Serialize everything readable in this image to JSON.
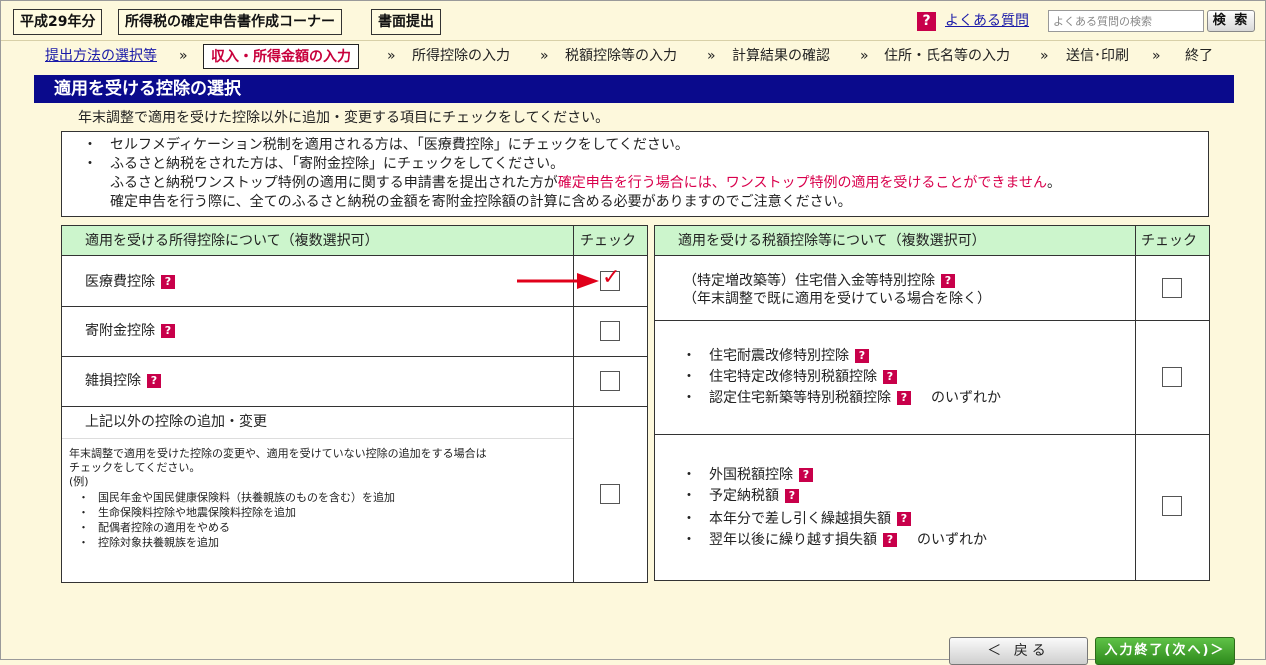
{
  "header": {
    "year": "平成29年分",
    "title": "所得税の確定申告書作成コーナー",
    "mode": "書面提出",
    "faq_link": "よくある質問",
    "faq_placeholder": "よくある質問の検索",
    "search_button": "検 索"
  },
  "steps": [
    {
      "label": "提出方法の選択等",
      "state": "link"
    },
    {
      "label": "収入・所得金額の入力",
      "state": "current"
    },
    {
      "label": "所得控除の入力",
      "state": "normal"
    },
    {
      "label": "税額控除等の入力",
      "state": "normal"
    },
    {
      "label": "計算結果の確認",
      "state": "normal"
    },
    {
      "label": "住所・氏名等の入力",
      "state": "normal"
    },
    {
      "label": "送信･印刷",
      "state": "normal"
    },
    {
      "label": "終了",
      "state": "normal"
    }
  ],
  "step_separator": "»",
  "section_title": "適用を受ける控除の選択",
  "instruction": "年末調整で適用を受けた控除以外に追加・変更する項目にチェックをしてください。",
  "notice": {
    "bullet": "・",
    "line1": "セルフメディケーション税制を適用される方は、「医療費控除」にチェックをしてください。",
    "line2": "ふるさと納税をされた方は、「寄附金控除」にチェックをしてください。",
    "line3_a": "ふるさと納税ワンストップ特例の適用に関する申請書を提出された方が",
    "line3_red": "確定申告を行う場合には、ワンストップ特例の適用を受けることができません",
    "line3_b": "。",
    "line4": "確定申告を行う際に、全てのふるさと納税の金額を寄附金控除額の計算に含める必要がありますのでご注意ください。"
  },
  "left_table": {
    "header": "適用を受ける所得控除について（複数選択可）",
    "check_header": "チェック",
    "rows": {
      "medical": {
        "label": "医療費控除",
        "checked": true
      },
      "donation": {
        "label": "寄附金控除",
        "checked": false
      },
      "casualty": {
        "label": "雑損控除",
        "checked": false
      }
    },
    "other": {
      "label": "上記以外の控除の追加・変更",
      "desc1": "年末調整で適用を受けた控除の変更や、適用を受けていない控除の追加をする場合は",
      "desc2": "チェックをしてください。",
      "example": "(例)",
      "bullet": "・",
      "ex1": "国民年金や国民健康保険料（扶養親族のものを含む）を追加",
      "ex2": "生命保険料控除や地震保険料控除を追加",
      "ex3": "配偶者控除の適用をやめる",
      "ex4": "控除対象扶養親族を追加",
      "checked": false
    }
  },
  "right_table": {
    "header": "適用を受ける税額控除等について（複数選択可）",
    "check_header": "チェック",
    "bullet": "・",
    "row1": {
      "label": "（特定増改築等）住宅借入金等特別控除",
      "note": "（年末調整で既に適用を受けている場合を除く）",
      "checked": false
    },
    "row2": {
      "item1": "住宅耐震改修特別控除",
      "item2": "住宅特定改修特別税額控除",
      "item3": "認定住宅新築等特別税額控除",
      "suffix": "のいずれか",
      "checked": false
    },
    "row3": {
      "item1": "外国税額控除",
      "item2": "予定納税額",
      "item3": "本年分で差し引く繰越損失額",
      "item4": "翌年以後に繰り越す損失額",
      "suffix": "のいずれか",
      "checked": false
    }
  },
  "help_glyph": "?",
  "check_glyph": "✓",
  "buttons": {
    "back": "＜ 戻る",
    "next": "入力終了(次へ)＞"
  },
  "colors": {
    "title_bar": "#0a0a8c",
    "table_header": "#ccf5cc",
    "accent_red": "#d9004c",
    "help_icon": "#c8004a",
    "next_button": "#2e8a1c"
  }
}
